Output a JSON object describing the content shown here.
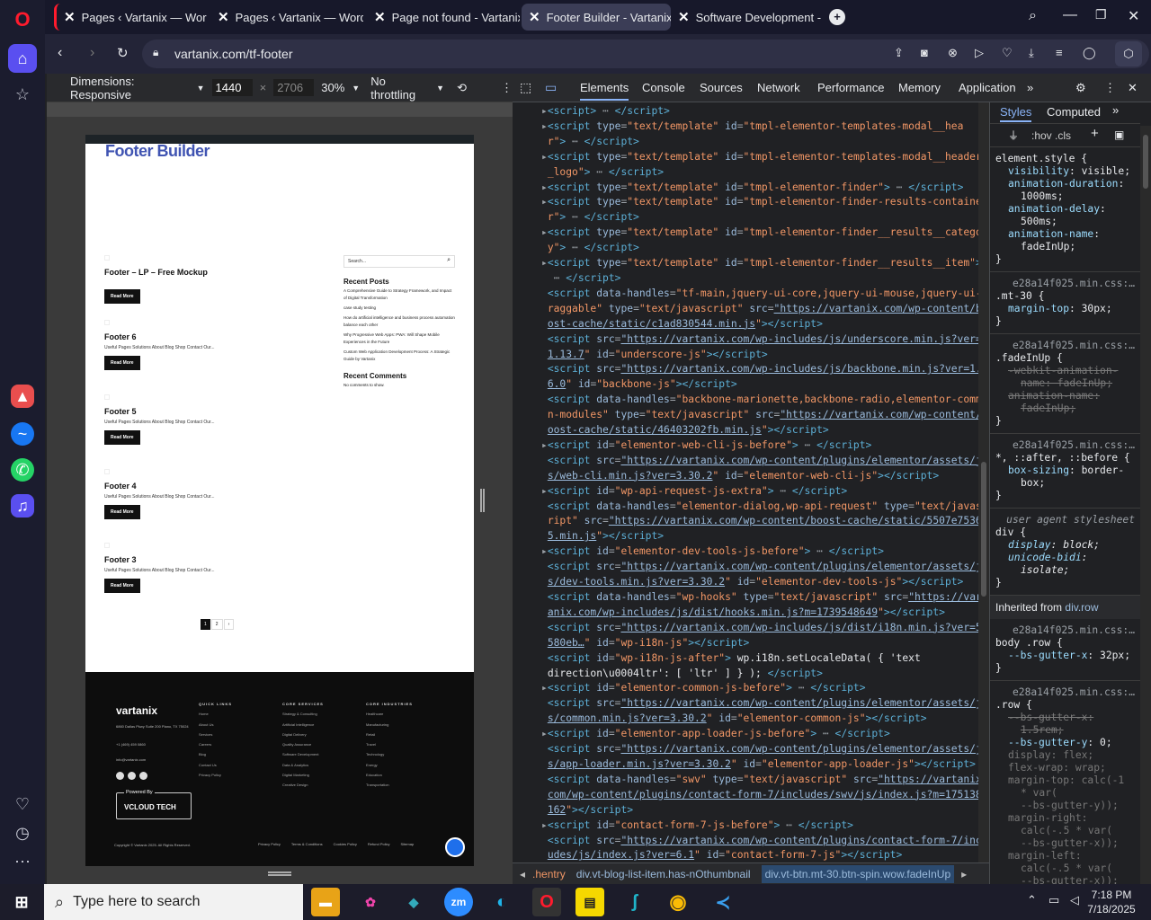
{
  "browser": {
    "tabs": [
      {
        "label": "Pages ‹ Vartanix — WordP"
      },
      {
        "label": "Pages ‹ Vartanix — WordP"
      },
      {
        "label": "Page not found - Vartanix"
      },
      {
        "label": "Footer Builder - Vartanix"
      },
      {
        "label": "Software Development - V"
      }
    ],
    "url": "vartanix.com/tf-footer"
  },
  "device_toolbar": {
    "dimensions": "Dimensions: Responsive",
    "width": "1440",
    "height": "2706",
    "zoom": "30%",
    "throttling": "No throttling"
  },
  "page": {
    "title": "Footer Builder",
    "posts": [
      {
        "title": "Footer – LP – Free Mockup",
        "excerpt": "",
        "button": "Read More"
      },
      {
        "title": "Footer 6",
        "excerpt": "Useful Pages Solutions About Blog Shop Contact Our...",
        "button": "Read More"
      },
      {
        "title": "Footer 5",
        "excerpt": "Useful Pages Solutions About Blog Shop Contact Our...",
        "button": "Read More"
      },
      {
        "title": "Footer 4",
        "excerpt": "Useful Pages Solutions About Blog Shop Contact Our...",
        "button": "Read More"
      },
      {
        "title": "Footer 3",
        "excerpt": "Useful Pages Solutions About Blog Shop Contact Our...",
        "button": "Read More"
      }
    ],
    "pagination": [
      "1",
      "2",
      "›"
    ],
    "sidebar": {
      "search_placeholder": "Search...",
      "recent_posts_title": "Recent Posts",
      "recent_posts": [
        "A Comprehensive Guide to Strategy Framework, and Impact of Digital Transformation",
        "case study testing",
        "How do artificial intelligence and business process automation balance each other",
        "Why Progressive Web Apps: PWA: Will Shape Mobile Experiences in the Future",
        "Custom Web Application Development Process: A Strategic Guide by Vartanix"
      ],
      "recent_comments_title": "Recent Comments",
      "no_comments": "No comments to show."
    },
    "footer": {
      "logo": "vartanix",
      "address": "6860 Dallas Pkwy Suite 200 Plano, TX 75024",
      "phone": "+1 (469) 459 0860",
      "email": "info@vartanix.com",
      "quick_links_title": "QUICK LINKS",
      "quick_links": [
        "Home",
        "About Us",
        "Services",
        "Careers",
        "Blog",
        "Contact Us",
        "Privacy Policy"
      ],
      "core_services_title": "CORE SERVICES",
      "core_services": [
        "Strategy & Consulting",
        "Artificial Intelligence",
        "Digital Delivery",
        "Quality Assurance",
        "Software Development",
        "Data & Analytics",
        "Digital Marketing",
        "Creative Design"
      ],
      "core_industries_title": "CORE INDUSTRIES",
      "core_industries": [
        "Healthcare",
        "Manufacturing",
        "Retail",
        "Travel",
        "Technology",
        "Energy",
        "Education",
        "Transportation"
      ],
      "powered_by": "Powered By",
      "powered_brand": "VCLOUD TECH",
      "copyright": "Copyright © Vartanix 2025. All Rights Reserved.",
      "bottom_links": [
        "Privacy Policy",
        "Terms & Conditions",
        "Cookies Policy",
        "Refund Policy",
        "Sitemap"
      ]
    }
  },
  "devtools": {
    "tabs": [
      "Elements",
      "Console",
      "Sources",
      "Network",
      "Performance",
      "Memory",
      "Application"
    ],
    "styles_tabs": [
      "Styles",
      "Computed"
    ],
    "filter": ":hov .cls",
    "breadcrumb": [
      ".hentry",
      "div.vt-blog-list-item.has-nOthumbnail",
      "div.vt-btn.mt-30.btn-spin.wow.fadeInUp"
    ],
    "inherited_label": "Inherited from",
    "inherited_from": "div.row"
  },
  "taskbar": {
    "search_placeholder": "Type here to search",
    "time": "7:18 PM",
    "date": "7/18/2025"
  },
  "colors": {
    "accent": "#4054b2",
    "active_tab": "#3b3d56",
    "devtools_bg": "#202124",
    "tag": "#5db0d7",
    "attr_value": "#f29766"
  }
}
